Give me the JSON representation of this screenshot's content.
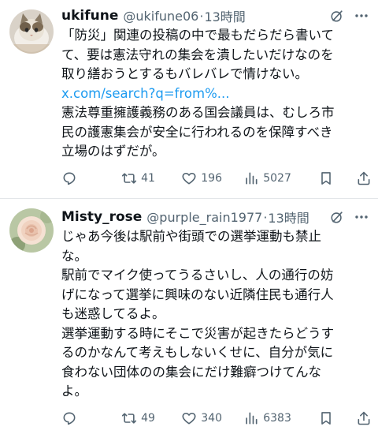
{
  "tweets": [
    {
      "name": "ukifune",
      "handle": "@ukifune06",
      "dot": "·",
      "time": "13時間",
      "lines": [
        "「防災」関連の投稿の中で最もだらだら書いて",
        "て、要は憲法守れの集会を潰したいだけなのを",
        "取り繕おうとするもバレバレで情けない。",
        "x.com/search?q=from%...",
        "憲法尊重擁護義務のある国会議員は、むしろ市",
        "民の護憲集会が安全に行われるのを保障すべき",
        "立場のはずだが。"
      ],
      "link_line_index": 3,
      "reply_count": "",
      "retweet_count": "41",
      "like_count": "196",
      "view_count": "5027",
      "avatar": "cat-photo"
    },
    {
      "name": "Misty_rose",
      "handle": "@purple_rain1977",
      "dot": "·",
      "time": "13時間",
      "lines": [
        "じゃあ今後は駅前や街頭での選挙運動も禁止",
        "な。",
        "駅前でマイク使ってうるさいし、人の通行の妨",
        "げになって選挙に興味のない近隣住民も通行人",
        "も迷惑してるよ。",
        "選挙運動する時にそこで災害が起きたらどうす",
        "るのかなんて考えもしないくせに、自分が気に",
        "食わない団体のの集会にだけ難癖つけてんな",
        "よ。"
      ],
      "reply_count": "",
      "retweet_count": "49",
      "like_count": "340",
      "view_count": "6383",
      "avatar": "rose-photo"
    }
  ],
  "icons": {
    "reply": "reply-icon",
    "retweet": "retweet-icon",
    "like": "heart-icon",
    "views": "views-icon",
    "bookmark": "bookmark-icon",
    "share": "share-icon",
    "grok": "grok-icon",
    "more": "more-icon"
  },
  "colors": {
    "text": "#0f1419",
    "secondary": "#536471",
    "link": "#1d9bf0",
    "divider": "#e3e6e9"
  }
}
